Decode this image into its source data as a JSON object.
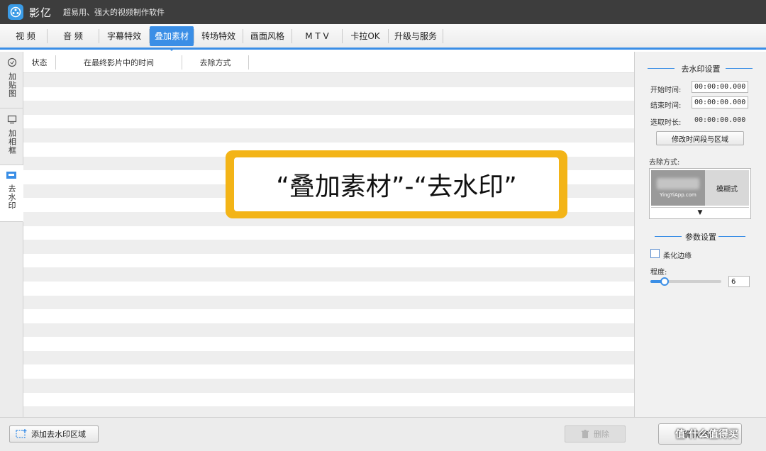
{
  "titlebar": {
    "app_name": "影亿",
    "slogan": "超易用、强大的视频制作软件"
  },
  "tabs": [
    {
      "label": "视  频"
    },
    {
      "label": "音  频"
    },
    {
      "label": "字幕特效"
    },
    {
      "label": "叠加素材",
      "active": true
    },
    {
      "label": "转场特效"
    },
    {
      "label": "画面风格"
    },
    {
      "label": "M T V"
    },
    {
      "label": "卡拉OK"
    },
    {
      "label": "升级与服务"
    }
  ],
  "side_tabs": [
    {
      "label": "加贴图"
    },
    {
      "label": "加相框"
    },
    {
      "label": "去水印",
      "active": true
    }
  ],
  "list": {
    "columns": [
      "状态",
      "在最终影片中的时间",
      "去除方式"
    ]
  },
  "callout": {
    "text": "“叠加素材”-“去水印”"
  },
  "panel": {
    "section_title": "去水印设置",
    "start_label": "开始时间:",
    "start_value": "00:00:00.000",
    "end_label": "结束时间:",
    "end_value": "00:00:00.000",
    "duration_label": "选取时长:",
    "duration_value": "00:00:00.000",
    "modify_button": "修改时间段与区域",
    "mode_label": "去除方式:",
    "mode_thumb_text": "YingYiApp.com",
    "mode_selected": "模糊式",
    "mode_dropdown_arrow": "▼",
    "param_title": "参数设置",
    "soften_label": "柔化边缘",
    "soften_checked": false,
    "degree_label": "程度:",
    "degree_value": "6",
    "degree_fraction": 0.2
  },
  "bottom": {
    "add_button": "添加去水印区域",
    "delete_button": "删除",
    "ok_button": "确认修改"
  },
  "overlay": {
    "watermark": "值 什么值得买"
  },
  "colors": {
    "accent": "#3a8ee6",
    "titlebar": "#3d3d3d",
    "callout": "#f3b417"
  }
}
